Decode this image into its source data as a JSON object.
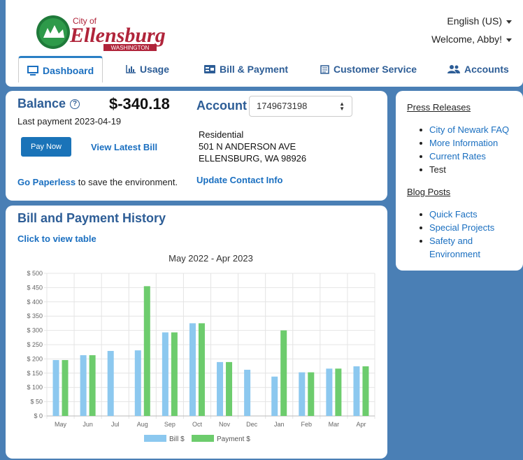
{
  "header": {
    "logo_text": "City of Ellensburg Washington",
    "language": "English (US)",
    "welcome": "Welcome, Abby!"
  },
  "tabs": [
    {
      "label": "Dashboard",
      "icon": "monitor-icon",
      "active": true
    },
    {
      "label": "Usage",
      "icon": "bar-chart-icon"
    },
    {
      "label": "Bill & Payment",
      "icon": "bill-icon"
    },
    {
      "label": "Customer Service",
      "icon": "form-icon"
    },
    {
      "label": "Accounts",
      "icon": "users-icon"
    }
  ],
  "balance": {
    "label": "Balance",
    "amount": "$-340.18",
    "last_payment": "Last payment 2023-04-19",
    "pay_now": "Pay Now",
    "view_bill": "View Latest Bill",
    "paperless_link": "Go Paperless",
    "paperless_text": " to save the environment."
  },
  "account": {
    "label": "Account",
    "number": "1749673198",
    "type": "Residential",
    "address1": "501 N ANDERSON AVE",
    "address2": "ELLENSBURG, WA 98926",
    "update_contact": "Update Contact Info"
  },
  "history": {
    "title": "Bill and Payment History",
    "click_table": "Click to view table"
  },
  "chart_data": {
    "type": "bar",
    "title": "May 2022 - Apr 2023",
    "categories": [
      "May",
      "Jun",
      "Jul",
      "Aug",
      "Sep",
      "Oct",
      "Nov",
      "Dec",
      "Jan",
      "Feb",
      "Mar",
      "Apr"
    ],
    "series": [
      {
        "name": "Bill $",
        "color": "#8cc8ef",
        "values": [
          196,
          213,
          228,
          230,
          293,
          325,
          189,
          162,
          138,
          153,
          166,
          174
        ]
      },
      {
        "name": "Payment $",
        "color": "#6dcc6d",
        "values": [
          196,
          213,
          0,
          455,
          293,
          325,
          189,
          0,
          300,
          153,
          166,
          174
        ]
      }
    ],
    "ylim": [
      0,
      500
    ],
    "yticks": [
      "$ 0",
      "$ 50",
      "$ 100",
      "$ 150",
      "$ 200",
      "$ 250",
      "$ 300",
      "$ 350",
      "$ 400",
      "$ 450",
      "$ 500"
    ],
    "grid": true,
    "legend": "bottom"
  },
  "sidebar": {
    "press_title": "Press Releases",
    "press_items": [
      "City of Newark FAQ",
      "More Information",
      "Current Rates",
      "Test"
    ],
    "blog_title": "Blog Posts",
    "blog_items": [
      "Quick Facts",
      "Special Projects",
      "Safety and Environment"
    ]
  }
}
